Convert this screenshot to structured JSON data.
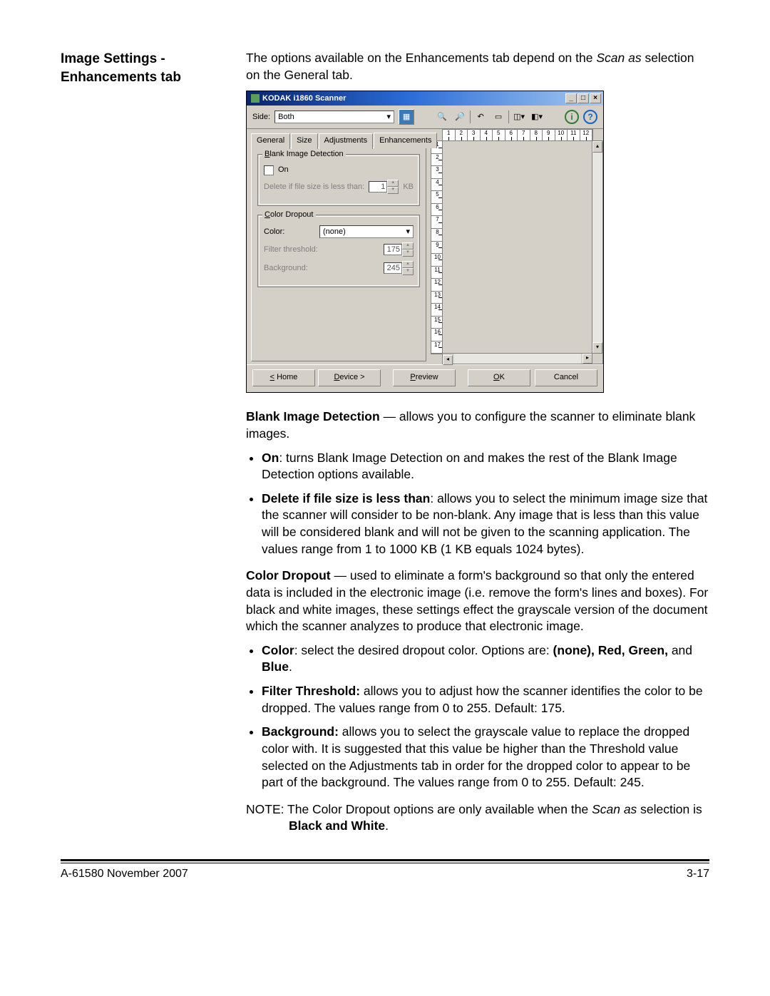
{
  "heading": "Image Settings - Enhancements tab",
  "intro_pre": "The options available on the Enhancements tab depend on the ",
  "intro_em": "Scan as",
  "intro_post": " selection on the General tab.",
  "window": {
    "title": "KODAK i1860 Scanner",
    "side_label": "Side:",
    "side_value": "Both",
    "tabs": [
      "General",
      "Size",
      "Adjustments",
      "Enhancements"
    ],
    "blank_group": "Blank Image Detection",
    "on_label": "On",
    "delete_label": "Delete if file size is less than:",
    "delete_value": "1",
    "kb": "KB",
    "color_group": "Color Dropout",
    "color_label": "Color:",
    "color_value": "(none)",
    "filter_label": "Filter threshold:",
    "filter_value": "175",
    "bg_label": "Background:",
    "bg_value": "245",
    "ruler_h": [
      "1",
      "2",
      "3",
      "4",
      "5",
      "6",
      "7",
      "8",
      "9",
      "10",
      "11",
      "12"
    ],
    "ruler_v": [
      "1",
      "2",
      "3",
      "4",
      "5",
      "6",
      "7",
      "8",
      "9",
      "10",
      "11",
      "12",
      "13",
      "14",
      "15",
      "16",
      "17"
    ],
    "buttons": {
      "home": "< Home",
      "device": "Device >",
      "preview": "Preview",
      "ok": "OK",
      "cancel": "Cancel"
    }
  },
  "para1_b": "Blank Image Detection",
  "para1_rest": " — allows you to configure the scanner to eliminate blank images.",
  "li1_b": "On",
  "li1_rest": ": turns Blank Image Detection on and makes the rest of the Blank Image Detection options available.",
  "li2_b": "Delete if file size is less than",
  "li2_rest": ": allows you to select the minimum image size that the scanner will consider to be non-blank. Any image that is less than this value will be considered blank and will not be given to the scanning application. The values range from 1 to 1000 KB (1 KB equals 1024 bytes).",
  "para2_b": "Color Dropout",
  "para2_rest": " — used to eliminate a form's background so that only the entered data is included in the electronic image (i.e. remove the form's lines and boxes). For black and white images, these settings effect the grayscale version of the document which the scanner analyzes to produce that electronic image.",
  "li3_b": "Color",
  "li3_mid": ": select the desired dropout color. Options are: ",
  "li3_b2": "(none), Red, Green,",
  "li3_and": " and ",
  "li3_b3": "Blue",
  "li3_dot": ".",
  "li4_b": "Filter Threshold:",
  "li4_rest": " allows you to adjust how the scanner identifies the color to be dropped. The values range from 0 to 255. Default: 175.",
  "li5_b": "Background:",
  "li5_rest": " allows you to select the grayscale value to replace the dropped color with. It is suggested that this value be higher than the Threshold value selected on the Adjustments tab in order for the dropped color to appear to be part of the background. The values range from 0 to 255. Default: 245.",
  "note_lead": "NOTE: The Color Dropout options are only available when the ",
  "note_em": "Scan as",
  "note_mid": " selection is ",
  "note_b": "Black and White",
  "note_dot": ".",
  "footer_left": "A-61580   November 2007",
  "footer_right": "3-17"
}
